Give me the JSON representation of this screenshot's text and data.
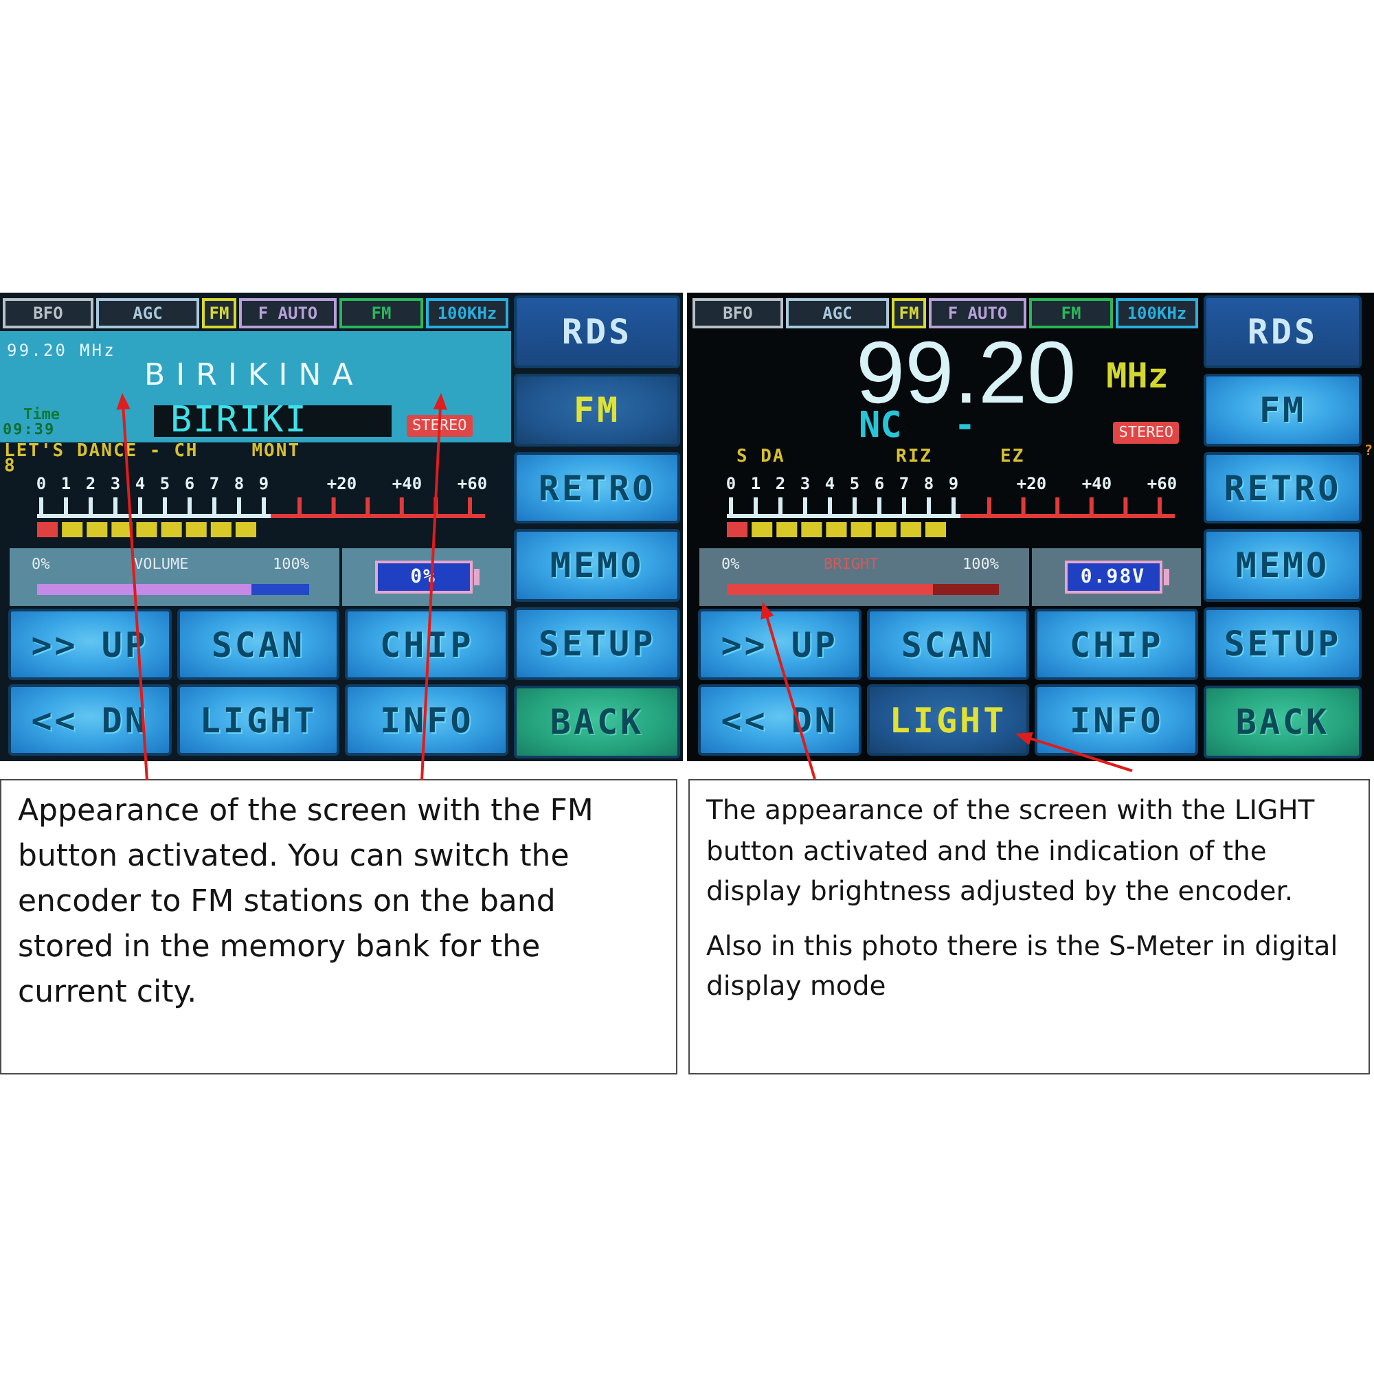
{
  "panels": [
    {
      "screen": {
        "kind": "rds",
        "status_tags": [
          {
            "label": "BFO",
            "color": "#b8c0c8"
          },
          {
            "label": "AGC",
            "color": "#a8c8dc"
          },
          {
            "label": "FM",
            "color": "#d8d830"
          },
          {
            "label": "F AUTO",
            "color": "#b8a0d8"
          },
          {
            "label": "FM",
            "color": "#28b858"
          },
          {
            "label": "100KHz",
            "color": "#28b0e0"
          }
        ],
        "display": {
          "frequency": "99.20 MHz",
          "station": "BIRIKINA",
          "time_label": "Time",
          "time": "09:39",
          "rds_name": [
            "BIRIKI"
          ],
          "stereo": "STEREO",
          "radio_text": [
            [
              "LET'S DANCE - CH",
              "MONT"
            ],
            [
              "8"
            ]
          ]
        },
        "s_meter": {
          "scale": [
            "0",
            "1",
            "2",
            "3",
            "4",
            "5",
            "6",
            "7",
            "8",
            "9",
            "+20",
            "+40",
            "+60"
          ],
          "level": 0.5
        },
        "slider": {
          "kind": "volume",
          "label": "VOLUME",
          "min": "0%",
          "max": "100%",
          "level": 0.79
        },
        "battery": "0%",
        "buttons": [
          {
            "label": ">> UP",
            "selected": false
          },
          {
            "label": "SCAN",
            "selected": false
          },
          {
            "label": "CHIP",
            "selected": false
          },
          {
            "label": "<< DN",
            "selected": false
          },
          {
            "label": "LIGHT",
            "selected": false
          },
          {
            "label": "INFO",
            "selected": false
          }
        ],
        "side_buttons": [
          {
            "label": "RDS",
            "kind": "toggle",
            "selected": false
          },
          {
            "label": "FM",
            "kind": "key",
            "selected": true
          },
          {
            "label": "RETRO",
            "kind": "key",
            "selected": false
          },
          {
            "label": "MEMO",
            "kind": "key",
            "selected": false
          },
          {
            "label": "SETUP",
            "kind": "key",
            "selected": false
          },
          {
            "label": "BACK",
            "kind": "exit",
            "selected": false
          }
        ]
      },
      "caption": {
        "paragraphs": [
          "Appearance of the screen with the FM button activated. You can switch the encoder to FM stations on the band stored in the memory bank for the current city."
        ]
      }
    },
    {
      "screen": {
        "kind": "frequency",
        "status_tags": [
          {
            "label": "BFO",
            "color": "#b8c0c8"
          },
          {
            "label": "AGC",
            "color": "#a8c8dc"
          },
          {
            "label": "FM",
            "color": "#d8d830"
          },
          {
            "label": "F AUTO",
            "color": "#b8a0d8"
          },
          {
            "label": "FM",
            "color": "#28b858"
          },
          {
            "label": "100KHz",
            "color": "#28b0e0"
          }
        ],
        "display": {
          "frequency": "99.20",
          "unit": "MHz",
          "rds_name": [
            "NC",
            "-"
          ],
          "stereo": "STEREO",
          "radio_text": [
            [
              "S DA",
              "RIZ",
              "EZ"
            ]
          ]
        },
        "s_meter": {
          "scale": [
            "0",
            "1",
            "2",
            "3",
            "4",
            "5",
            "6",
            "7",
            "8",
            "9",
            "+20",
            "+40",
            "+60"
          ],
          "level": 0.5
        },
        "slider": {
          "kind": "brightness",
          "label": "BRIGHT",
          "min": "0%",
          "max": "100%",
          "level": 0.76
        },
        "battery": "0.98V",
        "buttons": [
          {
            "label": ">> UP",
            "selected": false
          },
          {
            "label": "SCAN",
            "selected": false
          },
          {
            "label": "CHIP",
            "selected": false
          },
          {
            "label": "<< DN",
            "selected": false
          },
          {
            "label": "LIGHT",
            "selected": true
          },
          {
            "label": "INFO",
            "selected": false
          }
        ],
        "side_buttons": [
          {
            "label": "RDS",
            "kind": "toggle",
            "selected": false
          },
          {
            "label": "FM",
            "kind": "key",
            "selected": false
          },
          {
            "label": "RETRO",
            "kind": "key",
            "selected": false
          },
          {
            "label": "MEMO",
            "kind": "key",
            "selected": false
          },
          {
            "label": "SETUP",
            "kind": "key",
            "selected": false
          },
          {
            "label": "BACK",
            "kind": "exit",
            "selected": false
          }
        ],
        "corner_mark": "?"
      },
      "caption": {
        "paragraphs": [
          "The appearance of the screen with the LIGHT button activated and the indication of the display brightness adjusted by the encoder.",
          "Also in this photo there is the S-Meter in digital display mode"
        ]
      }
    }
  ]
}
